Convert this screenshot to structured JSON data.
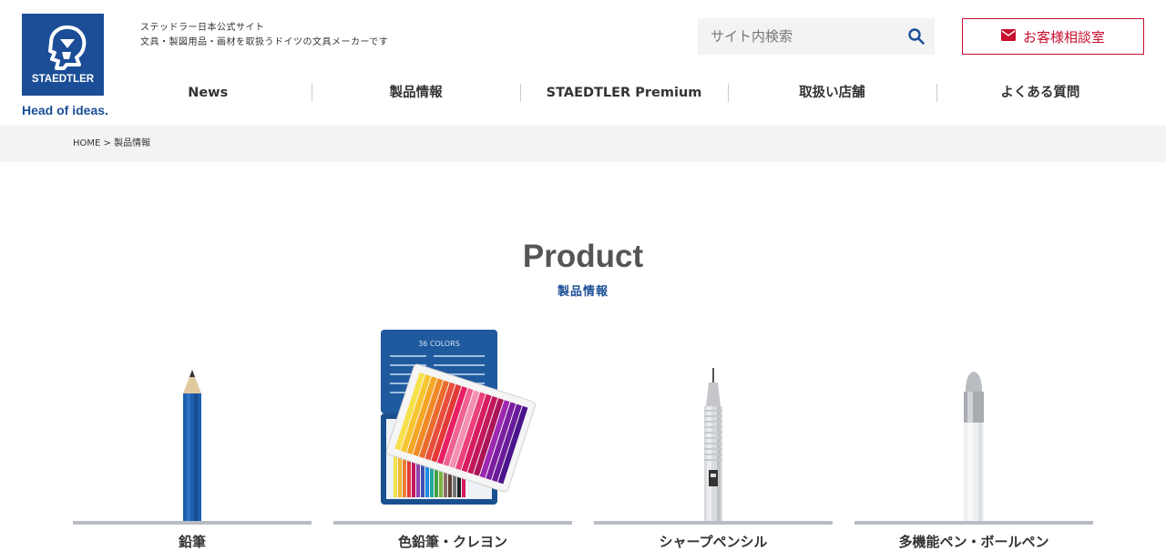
{
  "brand": {
    "name": "STAEDTLER",
    "slogan": "Head of ideas.",
    "color": "#1b4e97"
  },
  "tagline": {
    "line1": "ステッドラー日本公式サイト",
    "line2": "文具・製図用品・画材を取扱うドイツの文具メーカーです"
  },
  "search": {
    "placeholder": "サイト内検索",
    "icon": "search-icon"
  },
  "contact": {
    "label": "お客様相談室",
    "icon": "envelope-icon",
    "color": "#c8102e"
  },
  "nav": {
    "items": [
      {
        "label": "News"
      },
      {
        "label": "製品情報"
      },
      {
        "label": "STAEDTLER Premium"
      },
      {
        "label": "取扱い店舗"
      },
      {
        "label": "よくある質問"
      }
    ]
  },
  "breadcrumb": {
    "home": "HOME",
    "separator": ">",
    "current": "製品情報"
  },
  "main": {
    "title": "Product",
    "subtitle": "製品情報"
  },
  "products": [
    {
      "label": "鉛筆",
      "icon": "pencil-image"
    },
    {
      "label": "色鉛筆・クレヨン",
      "icon": "colored-pencils-tin-image"
    },
    {
      "label": "シャープペンシル",
      "icon": "mechanical-pencil-image"
    },
    {
      "label": "多機能ペン・ボールペン",
      "icon": "multi-pen-image"
    }
  ]
}
